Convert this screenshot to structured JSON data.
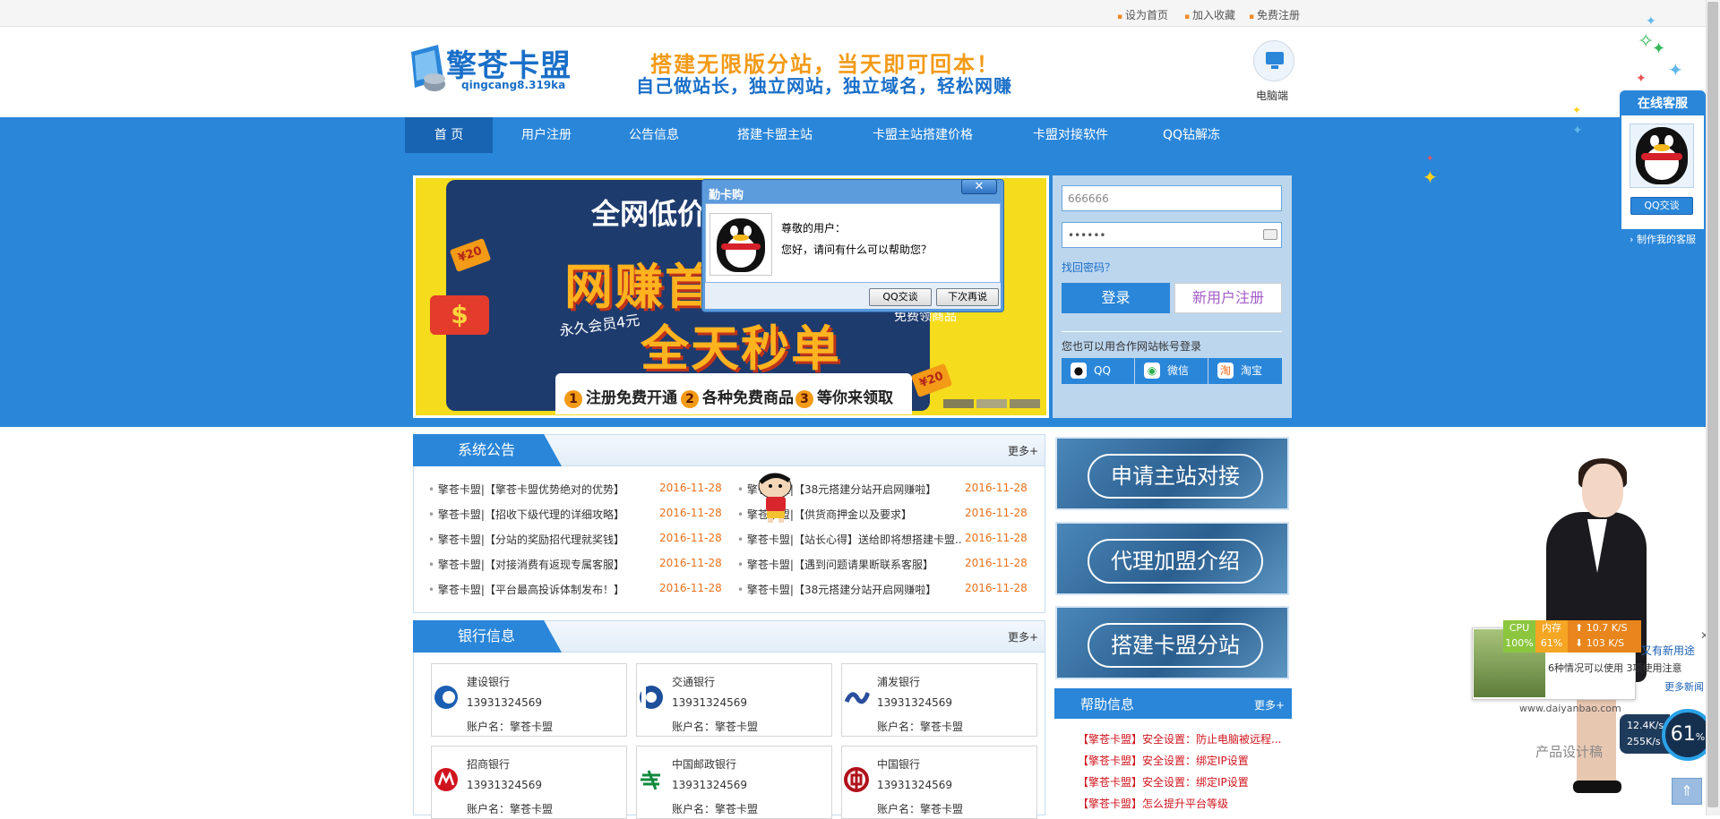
{
  "topbar": {
    "links": [
      "设为首页",
      "加入收藏",
      "免费注册"
    ]
  },
  "header": {
    "logo_text": "擎苍卡盟",
    "logo_sub": "qingcang8.319ka",
    "slogan_line1": "搭建无限版分站，当天即可回本！",
    "slogan_line2": "自己做站长，独立网站，独立域名，轻松网赚",
    "pc_label": "电脑端"
  },
  "nav": {
    "items": [
      "首  页",
      "用户注册",
      "公告信息",
      "搭建卡盟主站",
      "卡盟主站搭建价格",
      "卡盟对接软件",
      "QQ钻解冻"
    ]
  },
  "banner": {
    "top_text": "全网低价",
    "big1": "网赚首",
    "big2": "全天秒单",
    "member_text": "永久会员4元",
    "right_text": "免费领商品",
    "tag": "¥20",
    "coin": "$",
    "steps": [
      {
        "num": "1",
        "text": "注册免费开通"
      },
      {
        "num": "2",
        "text": "各种免费商品"
      },
      {
        "num": "3",
        "text": "等你来领取"
      }
    ]
  },
  "login": {
    "username_value": "666666",
    "password_value": "••••••",
    "forgot": "找回密码？",
    "login_btn": "登录",
    "register_btn": "新用户注册",
    "alt_text": "您也可以用合作网站帐号登录",
    "alt_buttons": [
      "QQ",
      "微信",
      "淘宝"
    ]
  },
  "dialog": {
    "title": "勤卡购",
    "close": "✕",
    "line1": "尊敬的用户：",
    "line2": "您好，请问有什么可以帮助您？",
    "btn_chat": "QQ交谈",
    "btn_later": "下次再说"
  },
  "notices": {
    "title": "系统公告",
    "more": "更多+",
    "left": [
      {
        "text": "擎苍卡盟|【擎苍卡盟优势绝对的优势】",
        "date": "2016-11-28"
      },
      {
        "text": "擎苍卡盟|【招收下级代理的详细攻略】",
        "date": "2016-11-28"
      },
      {
        "text": "擎苍卡盟|【分站的奖励招代理就奖钱】",
        "date": "2016-11-28"
      },
      {
        "text": "擎苍卡盟|【对接消费有返现专属客服】",
        "date": "2016-11-28"
      },
      {
        "text": "擎苍卡盟|【平台最高投诉体制发布！】",
        "date": "2016-11-28"
      }
    ],
    "right": [
      {
        "text": "擎苍卡盟|【38元搭建分站开启网赚啦】",
        "date": "2016-11-28"
      },
      {
        "text": "擎苍卡盟|【供货商押金以及要求】",
        "date": "2016-11-28"
      },
      {
        "text": "擎苍卡盟|【站长心得】送给即将想搭建卡盟...",
        "date": "2016-11-28"
      },
      {
        "text": "擎苍卡盟|【遇到问题请果断联系客服】",
        "date": "2016-11-28"
      },
      {
        "text": "擎苍卡盟|【38元搭建分站开启网赚啦】",
        "date": "2016-11-28"
      }
    ]
  },
  "bank": {
    "title": "银行信息",
    "more": "更多+",
    "cards": [
      {
        "name": "建设银行",
        "number": "13931324569",
        "holder": "账户名：擎苍卡盟",
        "color": "#1a5fb4"
      },
      {
        "name": "交通银行",
        "number": "13931324569",
        "holder": "账户名：擎苍卡盟",
        "color": "#1d4f9a"
      },
      {
        "name": "浦发银行",
        "number": "13931324569",
        "holder": "账户名：擎苍卡盟",
        "color": "#2a4d9c"
      },
      {
        "name": "招商银行",
        "number": "13931324569",
        "holder": "账户名：擎苍卡盟",
        "color": "#d0141e"
      },
      {
        "name": "中国邮政银行",
        "number": "13931324569",
        "holder": "账户名：擎苍卡盟",
        "color": "#0f8a3c"
      },
      {
        "name": "中国银行",
        "number": "13931324569",
        "holder": "账户名：擎苍卡盟",
        "color": "#b0121b"
      }
    ]
  },
  "promos": [
    "申请主站对接",
    "代理加盟介绍",
    "搭建卡盟分站"
  ],
  "help": {
    "title": "帮助信息",
    "more": "更多+",
    "items": [
      "【擎苍卡盟】安全设置：防止电脑被远程...",
      "【擎苍卡盟】安全设置：绑定IP设置",
      "【擎苍卡盟】安全设置：绑定IP设置",
      "【擎苍卡盟】怎么提升平台等级"
    ]
  },
  "kefu": {
    "title": "在线客服",
    "chat_btn": "QQ交谈",
    "footer": "› 制作我的客服"
  },
  "monitor": {
    "cpu_label": "CPU",
    "cpu_value": "100%",
    "mem_label": "内存",
    "mem_value": "61%",
    "up": "10.7 K/S",
    "down": "103 K/S",
    "ad_title": "又有新用途",
    "ad_desc": "6种情况可以使用 3项使用注意",
    "ad_more": "更多新闻",
    "ad_close": "✕",
    "speed_up": "12.4K/s",
    "speed_down": "255K/s",
    "ring": "61",
    "ring_unit": "%",
    "site": "www.daiyanbao.com",
    "credit": "产品设计稿",
    "up_arrow": "⬆",
    "down_arrow": "⬇"
  },
  "totop": "⇑",
  "colors": {
    "brand_blue": "#2a86d9",
    "nav_active": "#1864b3",
    "date_orange": "#e9711c",
    "help_red": "#d0141e"
  }
}
